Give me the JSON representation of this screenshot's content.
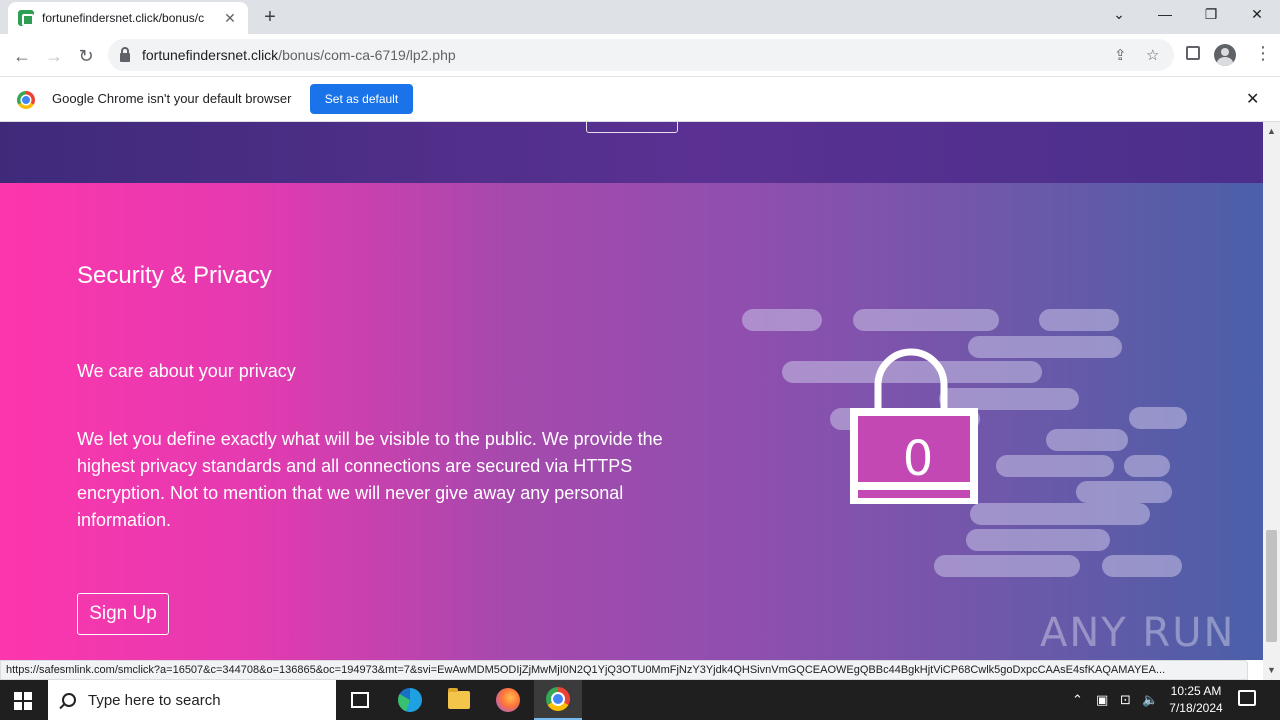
{
  "browser": {
    "tab_title": "fortunefindersnet.click/bonus/c",
    "new_tab_symbol": "+",
    "window_controls": {
      "minimize": "—",
      "restore": "❐",
      "close": "✕",
      "tab_search": "⌄"
    },
    "url_host": "fortunefindersnet.click",
    "url_path": "/bonus/com-ca-6719/lp2.php",
    "infobar_text": "Google Chrome isn't your default browser",
    "infobar_button": "Set as default",
    "status_url": "https://safesmlink.com/smclick?a=16507&c=344708&o=136865&oc=194973&mt=7&svi=EwAwMDM5ODIjZjMwMjI0N2Q1YjQ3OTU0MmFjNzY3Yjdk4QHSivnVmGQCEAOWEgQBBc44BgkHjtViCP68Cwlk5goDxpcCAAsE4sfKAQAMAYEA..."
  },
  "page": {
    "section_title": "Security & Privacy",
    "subtitle": "We care about your privacy",
    "body": "We let you define exactly what will be visible to the public. We provide the highest privacy standards and all connections are secured via HTTPS encryption. Not to mention that we will never give away any personal information.",
    "signup_label": "Sign Up",
    "lock_digit": "0",
    "watermark": "ANY RUN",
    "colors": {
      "gradient_start": "#fd36ad",
      "gradient_end": "#4b5fa8",
      "accent_blue": "#1a73e8"
    }
  },
  "taskbar": {
    "search_placeholder": "Type here to search",
    "time": "10:25 AM",
    "date": "7/18/2024",
    "apps": [
      "task-view-icon",
      "edge-icon",
      "file-explorer-icon",
      "firefox-icon",
      "chrome-icon"
    ]
  }
}
